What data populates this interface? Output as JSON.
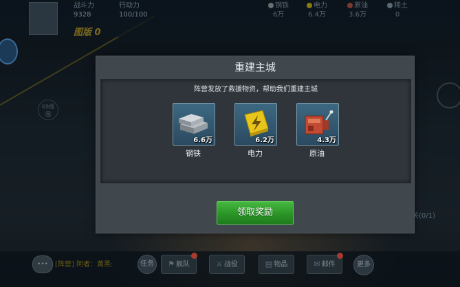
{
  "background": {
    "stats": [
      {
        "label": "战斗力",
        "value": "9328"
      },
      {
        "label": "行动力",
        "value": "100/100"
      }
    ],
    "guild": "图版 0",
    "resources": [
      {
        "name": "钢铁",
        "value": "6万",
        "color": "#6a6e70"
      },
      {
        "name": "电力",
        "value": "6.4万",
        "color": "#8a7a12"
      },
      {
        "name": "原油",
        "value": "3.6万",
        "color": "#7a3a30"
      },
      {
        "name": "稀土",
        "value": "0",
        "color": "#5a6a75"
      }
    ],
    "map_badge": "69周\n围",
    "right_text": "关(0/1)",
    "bottom": {
      "chat_icon": "•••",
      "chat_text": "[阵营]  阿者：黄黑:",
      "task": "任务",
      "nav": [
        {
          "label": "舰队",
          "icon": "⚑",
          "badge": true
        },
        {
          "label": "战役",
          "icon": "⚔",
          "badge": false
        },
        {
          "label": "物品",
          "icon": "▤",
          "badge": false
        },
        {
          "label": "邮件",
          "icon": "✉",
          "badge": true
        }
      ],
      "more": "更多"
    }
  },
  "modal": {
    "title": "重建主城",
    "description": "阵营发放了救援物资，帮助我们重建主城",
    "rewards": [
      {
        "name": "钢铁",
        "amount": "6.6万",
        "icon": "steel-ingot-icon"
      },
      {
        "name": "电力",
        "amount": "6.2万",
        "icon": "battery-icon"
      },
      {
        "name": "原油",
        "amount": "4.3万",
        "icon": "oil-pump-icon"
      }
    ],
    "claim_button": "领取奖励"
  },
  "colors": {
    "claim_button": "#2b9528",
    "reward_frame": "#3d6882",
    "modal_bg": "#40474d"
  }
}
